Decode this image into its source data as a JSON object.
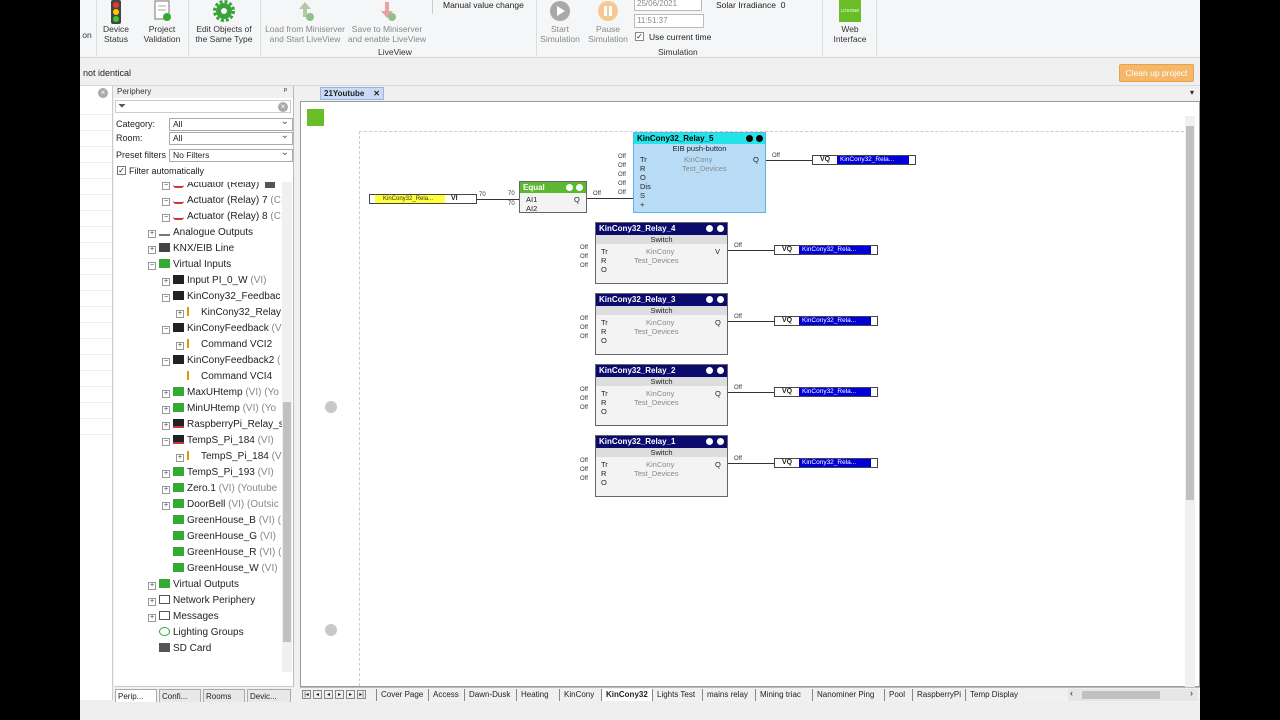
{
  "ribbon": {
    "partial_left": "on",
    "device_status": "Device\nStatus",
    "project_validation": "Project\nValidation",
    "edit_objects": "Edit Objects of\nthe Same Type",
    "load_liveview": "Load from Miniserver\nand Start LiveView",
    "save_liveview": "Save to Miniserver\nand enable LiveView",
    "manual_value_change": "Manual value change",
    "liveview_group": "LiveView",
    "start_sim": "Start\nSimulation",
    "pause_sim": "Pause\nSimulation",
    "date": "25/06/2021",
    "time": "11:51:37",
    "use_current_time": "Use current time",
    "solar_irradiance": "Solar Irradiance",
    "solar_value": "0",
    "simulation_group": "Simulation",
    "web_interface": "Web\nInterface",
    "loxone_tag": "LOXONE"
  },
  "infobar": {
    "message": "not identical",
    "cleanup": "Clean up project"
  },
  "periphery": {
    "title": "Periphery",
    "category_label": "Category:",
    "category_value": "All",
    "room_label": "Room:",
    "room_value": "All",
    "preset_label": "Preset filters",
    "preset_value": "No Filters",
    "filter_auto": "Filter automatically",
    "tree": [
      {
        "text": "Actuator (Relay)",
        "sub": ""
      },
      {
        "text": "Actuator (Relay) 7",
        "sub": " (C"
      },
      {
        "text": "Actuator (Relay) 8",
        "sub": " (C"
      },
      {
        "text": "Analogue Outputs",
        "sub": ""
      },
      {
        "text": "KNX/EIB Line",
        "sub": ""
      },
      {
        "text": "Virtual Inputs",
        "sub": ""
      },
      {
        "text": "Input PI_0_W",
        "sub": " (VI)"
      },
      {
        "text": "KinCony32_Feedbac",
        "sub": ""
      },
      {
        "text": "KinCony32_Relay",
        "sub": ""
      },
      {
        "text": "KinConyFeedback",
        "sub": " (V"
      },
      {
        "text": "Command VCI2",
        "sub": ""
      },
      {
        "text": "KinConyFeedback2",
        "sub": " ("
      },
      {
        "text": "Command VCI4",
        "sub": ""
      },
      {
        "text": "MaxUHtemp",
        "sub": " (VI) (Yo"
      },
      {
        "text": "MinUHtemp",
        "sub": " (VI) (Yo"
      },
      {
        "text": "RaspberryPi_Relay_s",
        "sub": ""
      },
      {
        "text": "TempS_Pi_184",
        "sub": " (VI)"
      },
      {
        "text": "TempS_Pi_184",
        "sub": " (V"
      },
      {
        "text": "TempS_Pi_193",
        "sub": " (VI)"
      },
      {
        "text": "Zero.1",
        "sub": " (VI) (Youtube"
      },
      {
        "text": "DoorBell",
        "sub": " (VI) (Outsic"
      },
      {
        "text": "GreenHouse_B",
        "sub": " (VI) ("
      },
      {
        "text": "GreenHouse_G",
        "sub": " (VI)"
      },
      {
        "text": "GreenHouse_R",
        "sub": " (VI) ("
      },
      {
        "text": "GreenHouse_W",
        "sub": " (VI)"
      },
      {
        "text": "Virtual Outputs",
        "sub": ""
      },
      {
        "text": "Network Periphery",
        "sub": ""
      },
      {
        "text": "Messages",
        "sub": ""
      },
      {
        "text": "Lighting Groups",
        "sub": ""
      },
      {
        "text": "SD Card",
        "sub": ""
      }
    ],
    "tabs": [
      "Perip...",
      "Confi...",
      "Rooms",
      "Devic..."
    ]
  },
  "doc_tab": "21Youtube",
  "blocks": {
    "relay5": {
      "title": "KinCony32_Relay_5",
      "type": "EIB push-button",
      "room": "KinCony",
      "cat": "Test_Devices",
      "inputs": [
        "Tr",
        "R",
        "O",
        "Dis",
        "S",
        "+"
      ],
      "out": "Q"
    },
    "equal": {
      "title": "Equal",
      "in1": "AI1",
      "in2": "AI2",
      "out": "Q",
      "v1": "70",
      "v2": "70"
    },
    "vi_label": "VI",
    "vi_name": "KinCony32_Rela...",
    "vi_value": "70",
    "relays": [
      {
        "title": "KinCony32_Relay_4",
        "type": "Switch",
        "room": "KinCony",
        "cat": "Test_Devices"
      },
      {
        "title": "KinCony32_Relay_3",
        "type": "Switch",
        "room": "KinCony",
        "cat": "Test_Devices"
      },
      {
        "title": "KinCony32_Relay_2",
        "type": "Switch",
        "room": "KinCony",
        "cat": "Test_Devices"
      },
      {
        "title": "KinCony32_Relay_1",
        "type": "Switch",
        "room": "KinCony",
        "cat": "Test_Devices"
      }
    ],
    "relay_inputs": [
      "Tr",
      "R",
      "O"
    ],
    "vq_label": "VQ",
    "vq_name": "KinCony32_Rela...",
    "off": "Off"
  },
  "bottom_tabs": [
    "Cover Page",
    "Access",
    "Dawn-Dusk",
    "Heating",
    "KinCony",
    "KinCony32",
    "Lights Test",
    "mains relay",
    "Mining triac",
    "Nanominer Ping",
    "Pool",
    "RaspberryPi",
    "Temp Display"
  ],
  "active_bottom_tab": "KinCony32",
  "colors": {
    "accent": "#f5b86a",
    "block_header": "#0b0b6e",
    "selected_block": "#b8dcf6",
    "vq_fill": "#0000d8",
    "vi_fill": "#ffff3c"
  }
}
